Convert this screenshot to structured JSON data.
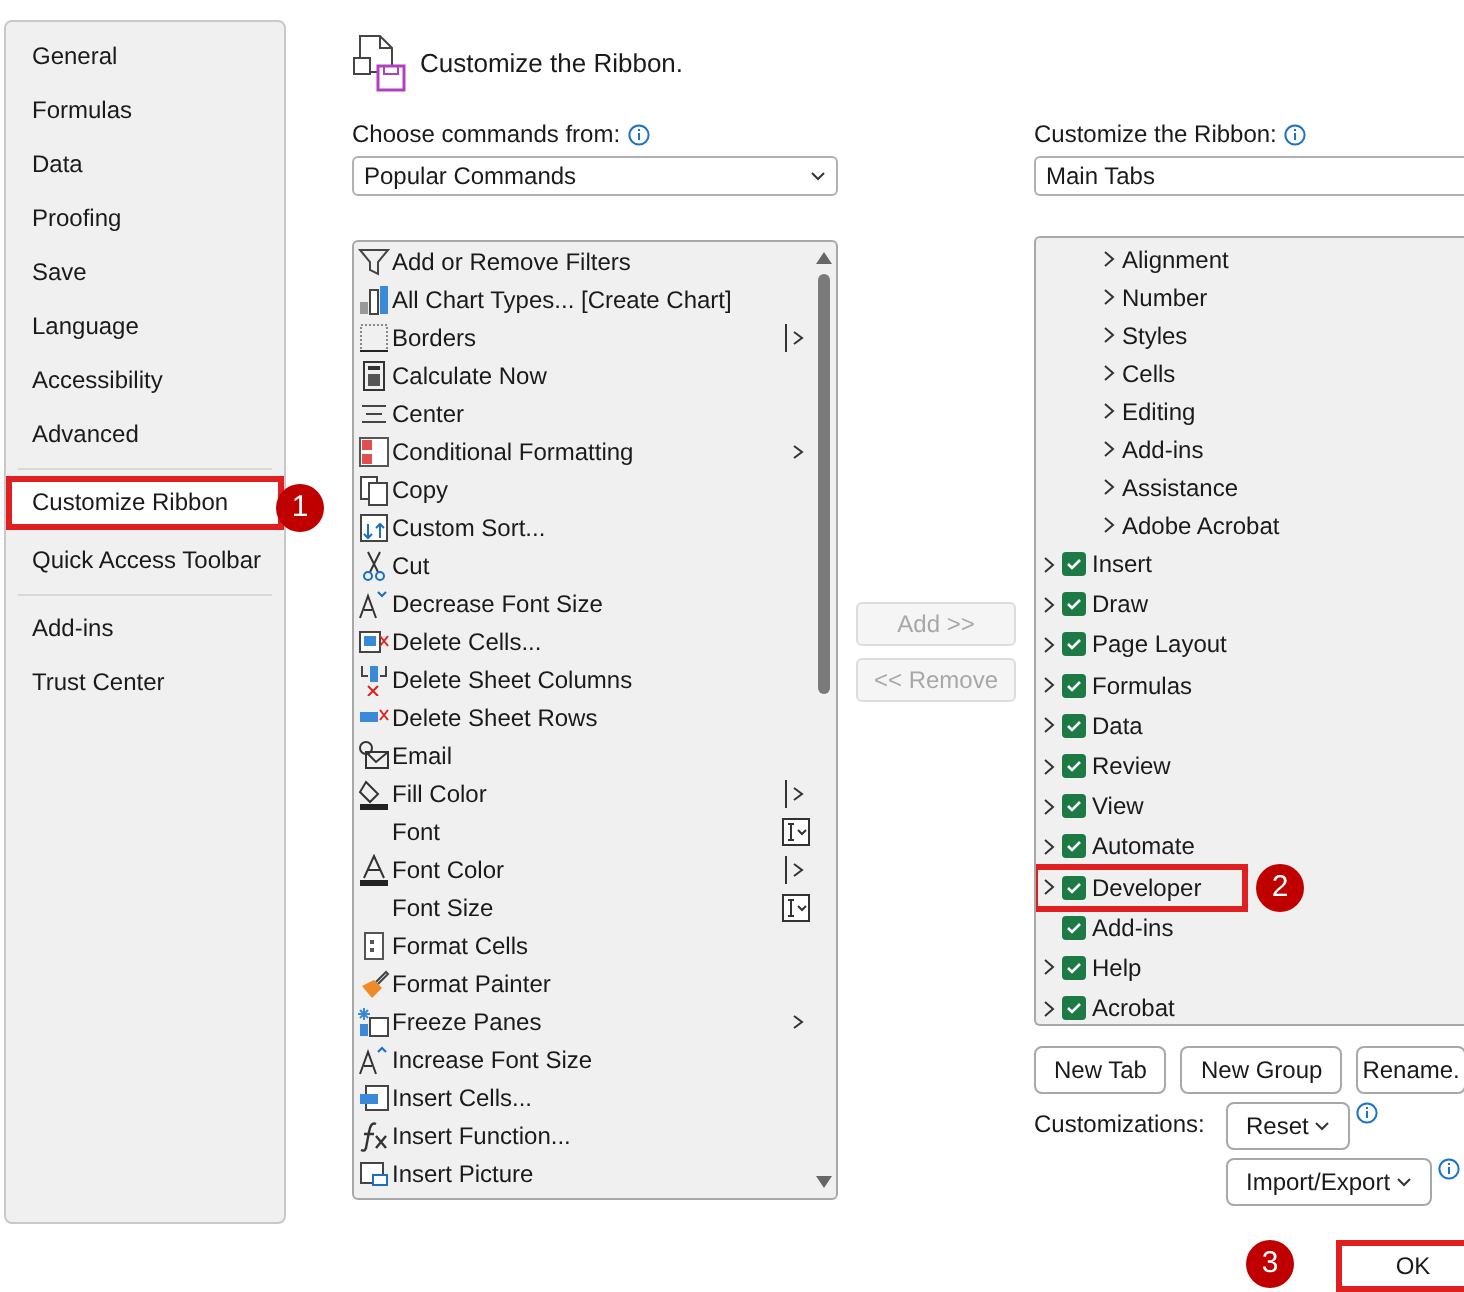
{
  "sidebar": {
    "items": [
      {
        "label": "General",
        "selected": false,
        "separator_after": false
      },
      {
        "label": "Formulas",
        "selected": false,
        "separator_after": false
      },
      {
        "label": "Data",
        "selected": false,
        "separator_after": false
      },
      {
        "label": "Proofing",
        "selected": false,
        "separator_after": false
      },
      {
        "label": "Save",
        "selected": false,
        "separator_after": false
      },
      {
        "label": "Language",
        "selected": false,
        "separator_after": false
      },
      {
        "label": "Accessibility",
        "selected": false,
        "separator_after": false
      },
      {
        "label": "Advanced",
        "selected": false,
        "separator_after": true
      },
      {
        "label": "Customize Ribbon",
        "selected": true,
        "separator_after": false,
        "callout": "1"
      },
      {
        "label": "Quick Access Toolbar",
        "selected": false,
        "separator_after": true
      },
      {
        "label": "Add-ins",
        "selected": false,
        "separator_after": false
      },
      {
        "label": "Trust Center",
        "selected": false,
        "separator_after": false
      }
    ]
  },
  "title": "Customize the Ribbon.",
  "commands": {
    "label": "Choose commands from:",
    "dropdown": "Popular Commands",
    "items": [
      {
        "label": "Add or Remove Filters",
        "kind": "plain"
      },
      {
        "label": "All Chart Types... [Create Chart]",
        "kind": "plain"
      },
      {
        "label": "Borders",
        "kind": "split"
      },
      {
        "label": "Calculate Now",
        "kind": "plain"
      },
      {
        "label": "Center",
        "kind": "plain"
      },
      {
        "label": "Conditional Formatting",
        "kind": "submenu"
      },
      {
        "label": "Copy",
        "kind": "plain"
      },
      {
        "label": "Custom Sort...",
        "kind": "plain"
      },
      {
        "label": "Cut",
        "kind": "plain"
      },
      {
        "label": "Decrease Font Size",
        "kind": "plain"
      },
      {
        "label": "Delete Cells...",
        "kind": "plain"
      },
      {
        "label": "Delete Sheet Columns",
        "kind": "plain"
      },
      {
        "label": "Delete Sheet Rows",
        "kind": "plain"
      },
      {
        "label": "Email",
        "kind": "plain"
      },
      {
        "label": "Fill Color",
        "kind": "split"
      },
      {
        "label": "Font",
        "kind": "field"
      },
      {
        "label": "Font Color",
        "kind": "split"
      },
      {
        "label": "Font Size",
        "kind": "field"
      },
      {
        "label": "Format Cells",
        "kind": "plain"
      },
      {
        "label": "Format Painter",
        "kind": "plain"
      },
      {
        "label": "Freeze Panes",
        "kind": "submenu"
      },
      {
        "label": "Increase Font Size",
        "kind": "plain"
      },
      {
        "label": "Insert Cells...",
        "kind": "plain"
      },
      {
        "label": "Insert Function...",
        "kind": "plain"
      },
      {
        "label": "Insert Picture",
        "kind": "plain"
      }
    ]
  },
  "middle_buttons": [
    {
      "label": "Add >>",
      "disabled": true
    },
    {
      "label": "<< Remove",
      "disabled": true
    }
  ],
  "ribbon": {
    "label": "Customize the Ribbon:",
    "dropdown": "Main Tabs",
    "scrolled_children": [
      "Alignment",
      "Number",
      "Styles",
      "Cells",
      "Editing",
      "Add-ins",
      "Assistance",
      "Adobe Acrobat"
    ],
    "tabs": [
      {
        "label": "Insert",
        "checked": true,
        "has_children": true
      },
      {
        "label": "Draw",
        "checked": true,
        "has_children": true
      },
      {
        "label": "Page Layout",
        "checked": true,
        "has_children": true
      },
      {
        "label": "Formulas",
        "checked": true,
        "has_children": true
      },
      {
        "label": "Data",
        "checked": true,
        "has_children": true
      },
      {
        "label": "Review",
        "checked": true,
        "has_children": true
      },
      {
        "label": "View",
        "checked": true,
        "has_children": true
      },
      {
        "label": "Automate",
        "checked": true,
        "has_children": true
      },
      {
        "label": "Developer",
        "checked": true,
        "has_children": true,
        "callout": "2"
      },
      {
        "label": "Add-ins",
        "checked": true,
        "has_children": false
      },
      {
        "label": "Help",
        "checked": true,
        "has_children": true
      },
      {
        "label": "Acrobat",
        "checked": true,
        "has_children": true
      }
    ],
    "buttons": [
      "New Tab",
      "New Group",
      "Rename."
    ],
    "customizations_label": "Customizations:",
    "reset": "Reset",
    "import_export": "Import/Export"
  },
  "ok": {
    "label": "OK",
    "callout": "3"
  }
}
